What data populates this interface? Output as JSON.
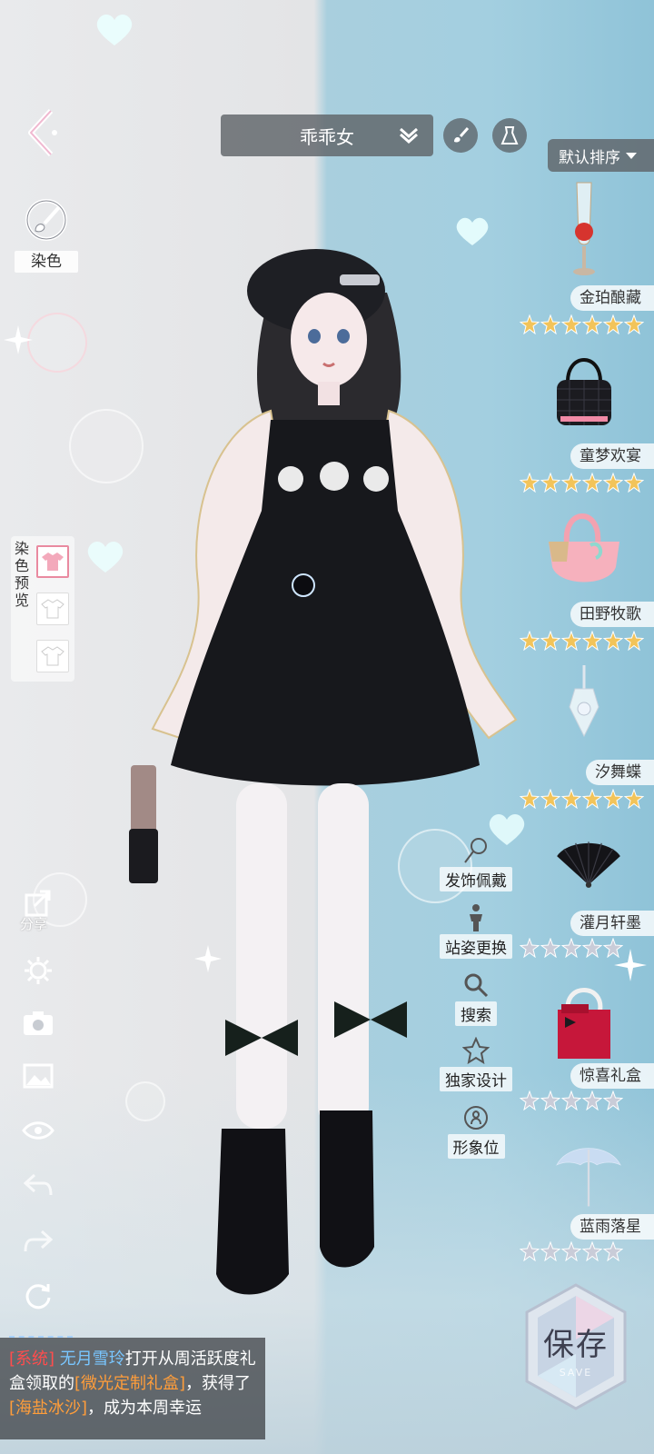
{
  "topbar": {
    "outfit_name": "乖乖女",
    "sort_label": "默认排序"
  },
  "left": {
    "dye_label": "染色",
    "dye_preview_label": "染色预览",
    "share_label": "分享"
  },
  "tools": [
    {
      "icon": "hair-flower-icon",
      "label": "发饰佩戴"
    },
    {
      "icon": "pose-figure-icon",
      "label": "站姿更换"
    },
    {
      "icon": "search-icon",
      "label": "搜索"
    },
    {
      "icon": "star-outline-icon",
      "label": "独家设计"
    },
    {
      "icon": "portrait-icon",
      "label": "形象位"
    }
  ],
  "items": [
    {
      "name": "金珀酿藏",
      "stars": 6,
      "star_color": "gold",
      "icon": "wine-glass-rose-icon"
    },
    {
      "name": "童梦欢宴",
      "stars": 6,
      "star_color": "gold",
      "icon": "quilted-bag-icon"
    },
    {
      "name": "田野牧歌",
      "stars": 6,
      "star_color": "gold",
      "icon": "pink-basket-bag-icon"
    },
    {
      "name": "汐舞蝶",
      "stars": 6,
      "star_color": "gold",
      "icon": "crystal-pendant-icon"
    },
    {
      "name": "灌月轩墨",
      "stars": 5,
      "star_color": "silver",
      "icon": "folding-fan-icon"
    },
    {
      "name": "惊喜礼盒",
      "stars": 5,
      "star_color": "silver",
      "icon": "gift-box-icon"
    },
    {
      "name": "蓝雨落星",
      "stars": 5,
      "star_color": "silver",
      "icon": "umbrella-icon"
    }
  ],
  "chat": {
    "system_tag": "[系统]",
    "user": "无月雪玲",
    "text1": "打开从周活跃度礼盒领取的",
    "gift": "[微光定制礼盒]",
    "text2": "，获得了",
    "prize": "[海盐冰沙]",
    "text3": "，成为本周幸运"
  },
  "save": {
    "label": "保存",
    "sub": "SAVE"
  },
  "colors": {
    "accent_pink": "#e98aa0",
    "star_gold": "#f2c45a",
    "star_silver": "#c9ccd8"
  }
}
